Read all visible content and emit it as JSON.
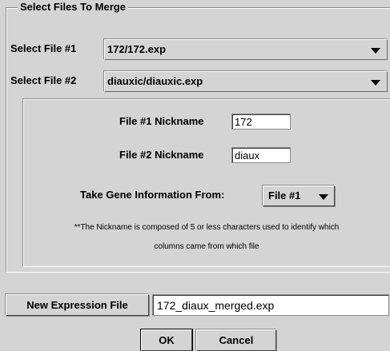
{
  "group": {
    "title": "Select Files To Merge"
  },
  "file1": {
    "label": "Select File #1",
    "value": "172/172.exp"
  },
  "file2": {
    "label": "Select File #2",
    "value": "diauxic/diauxic.exp"
  },
  "nick1": {
    "label": "File #1 Nickname",
    "value": "172"
  },
  "nick2": {
    "label": "File #2 Nickname",
    "value": "diaux"
  },
  "gene_info": {
    "label": "Take Gene Information From:",
    "value": "File #1"
  },
  "note": {
    "line1": "**The Nickname is composed of 5 or less characters used to identify which",
    "line2": "columns came from which file"
  },
  "output": {
    "button_label": "New Expression File",
    "value": "172_diaux_merged.exp"
  },
  "actions": {
    "ok_label": "OK",
    "cancel_label": "Cancel"
  }
}
